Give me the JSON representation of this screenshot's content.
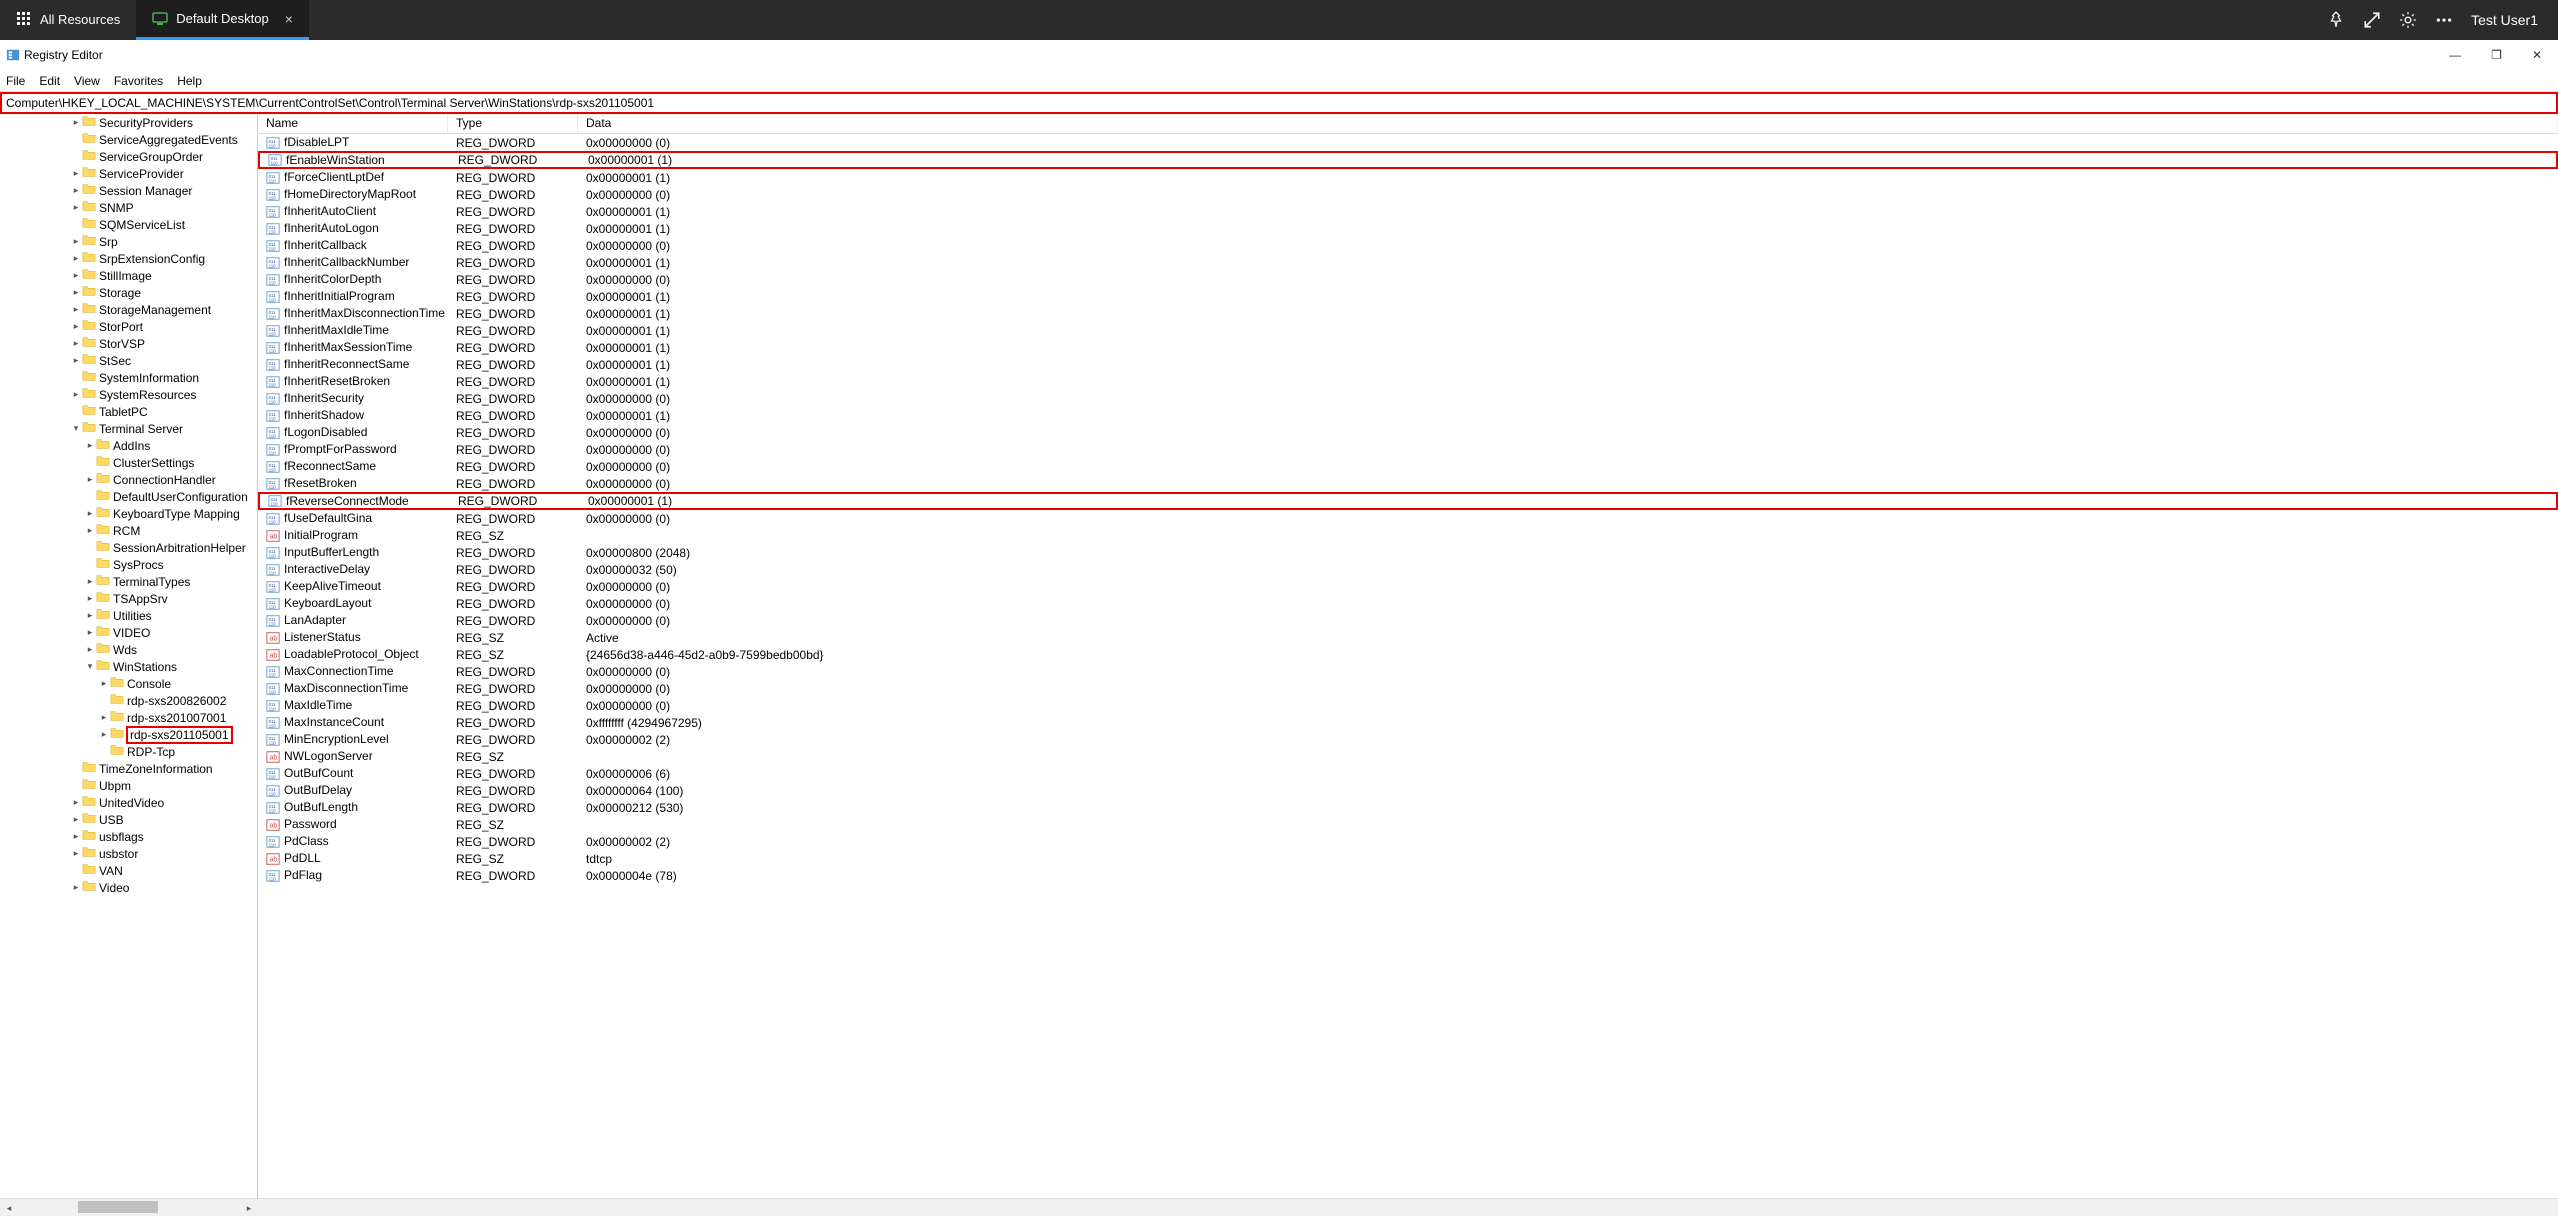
{
  "top_bar": {
    "all_resources": "All Resources",
    "active_tab": "Default Desktop",
    "user": "Test User1"
  },
  "window": {
    "title": "Registry Editor"
  },
  "menu": {
    "file": "File",
    "edit": "Edit",
    "view": "View",
    "favorites": "Favorites",
    "help": "Help"
  },
  "address": "Computer\\HKEY_LOCAL_MACHINE\\SYSTEM\\CurrentControlSet\\Control\\Terminal Server\\WinStations\\rdp-sxs201105001",
  "tree": [
    {
      "label": "SecurityProviders",
      "indent": 5,
      "exp": "▸"
    },
    {
      "label": "ServiceAggregatedEvents",
      "indent": 5,
      "exp": ""
    },
    {
      "label": "ServiceGroupOrder",
      "indent": 5,
      "exp": ""
    },
    {
      "label": "ServiceProvider",
      "indent": 5,
      "exp": "▸"
    },
    {
      "label": "Session Manager",
      "indent": 5,
      "exp": "▸"
    },
    {
      "label": "SNMP",
      "indent": 5,
      "exp": "▸"
    },
    {
      "label": "SQMServiceList",
      "indent": 5,
      "exp": ""
    },
    {
      "label": "Srp",
      "indent": 5,
      "exp": "▸"
    },
    {
      "label": "SrpExtensionConfig",
      "indent": 5,
      "exp": "▸"
    },
    {
      "label": "StillImage",
      "indent": 5,
      "exp": "▸"
    },
    {
      "label": "Storage",
      "indent": 5,
      "exp": "▸"
    },
    {
      "label": "StorageManagement",
      "indent": 5,
      "exp": "▸"
    },
    {
      "label": "StorPort",
      "indent": 5,
      "exp": "▸"
    },
    {
      "label": "StorVSP",
      "indent": 5,
      "exp": "▸"
    },
    {
      "label": "StSec",
      "indent": 5,
      "exp": "▸"
    },
    {
      "label": "SystemInformation",
      "indent": 5,
      "exp": ""
    },
    {
      "label": "SystemResources",
      "indent": 5,
      "exp": "▸"
    },
    {
      "label": "TabletPC",
      "indent": 5,
      "exp": ""
    },
    {
      "label": "Terminal Server",
      "indent": 5,
      "exp": "▾"
    },
    {
      "label": "AddIns",
      "indent": 6,
      "exp": "▸"
    },
    {
      "label": "ClusterSettings",
      "indent": 6,
      "exp": ""
    },
    {
      "label": "ConnectionHandler",
      "indent": 6,
      "exp": "▸"
    },
    {
      "label": "DefaultUserConfiguration",
      "indent": 6,
      "exp": ""
    },
    {
      "label": "KeyboardType Mapping",
      "indent": 6,
      "exp": "▸"
    },
    {
      "label": "RCM",
      "indent": 6,
      "exp": "▸"
    },
    {
      "label": "SessionArbitrationHelper",
      "indent": 6,
      "exp": ""
    },
    {
      "label": "SysProcs",
      "indent": 6,
      "exp": ""
    },
    {
      "label": "TerminalTypes",
      "indent": 6,
      "exp": "▸"
    },
    {
      "label": "TSAppSrv",
      "indent": 6,
      "exp": "▸"
    },
    {
      "label": "Utilities",
      "indent": 6,
      "exp": "▸"
    },
    {
      "label": "VIDEO",
      "indent": 6,
      "exp": "▸"
    },
    {
      "label": "Wds",
      "indent": 6,
      "exp": "▸"
    },
    {
      "label": "WinStations",
      "indent": 6,
      "exp": "▾"
    },
    {
      "label": "Console",
      "indent": 7,
      "exp": "▸"
    },
    {
      "label": "rdp-sxs200826002",
      "indent": 7,
      "exp": ""
    },
    {
      "label": "rdp-sxs201007001",
      "indent": 7,
      "exp": "▸"
    },
    {
      "label": "rdp-sxs201105001",
      "indent": 7,
      "exp": "▸",
      "selected": true
    },
    {
      "label": "RDP-Tcp",
      "indent": 7,
      "exp": ""
    },
    {
      "label": "TimeZoneInformation",
      "indent": 5,
      "exp": ""
    },
    {
      "label": "Ubpm",
      "indent": 5,
      "exp": ""
    },
    {
      "label": "UnitedVideo",
      "indent": 5,
      "exp": "▸"
    },
    {
      "label": "USB",
      "indent": 5,
      "exp": "▸"
    },
    {
      "label": "usbflags",
      "indent": 5,
      "exp": "▸"
    },
    {
      "label": "usbstor",
      "indent": 5,
      "exp": "▸"
    },
    {
      "label": "VAN",
      "indent": 5,
      "exp": ""
    },
    {
      "label": "Video",
      "indent": 5,
      "exp": "▸"
    }
  ],
  "list_header": {
    "name": "Name",
    "type": "Type",
    "data": "Data"
  },
  "values": [
    {
      "name": "fDisableLPT",
      "type": "REG_DWORD",
      "data": "0x00000000 (0)",
      "icon": "bin"
    },
    {
      "name": "fEnableWinStation",
      "type": "REG_DWORD",
      "data": "0x00000001 (1)",
      "icon": "bin",
      "hl": true
    },
    {
      "name": "fForceClientLptDef",
      "type": "REG_DWORD",
      "data": "0x00000001 (1)",
      "icon": "bin"
    },
    {
      "name": "fHomeDirectoryMapRoot",
      "type": "REG_DWORD",
      "data": "0x00000000 (0)",
      "icon": "bin"
    },
    {
      "name": "fInheritAutoClient",
      "type": "REG_DWORD",
      "data": "0x00000001 (1)",
      "icon": "bin"
    },
    {
      "name": "fInheritAutoLogon",
      "type": "REG_DWORD",
      "data": "0x00000001 (1)",
      "icon": "bin"
    },
    {
      "name": "fInheritCallback",
      "type": "REG_DWORD",
      "data": "0x00000000 (0)",
      "icon": "bin"
    },
    {
      "name": "fInheritCallbackNumber",
      "type": "REG_DWORD",
      "data": "0x00000001 (1)",
      "icon": "bin"
    },
    {
      "name": "fInheritColorDepth",
      "type": "REG_DWORD",
      "data": "0x00000000 (0)",
      "icon": "bin"
    },
    {
      "name": "fInheritInitialProgram",
      "type": "REG_DWORD",
      "data": "0x00000001 (1)",
      "icon": "bin"
    },
    {
      "name": "fInheritMaxDisconnectionTime",
      "type": "REG_DWORD",
      "data": "0x00000001 (1)",
      "icon": "bin"
    },
    {
      "name": "fInheritMaxIdleTime",
      "type": "REG_DWORD",
      "data": "0x00000001 (1)",
      "icon": "bin"
    },
    {
      "name": "fInheritMaxSessionTime",
      "type": "REG_DWORD",
      "data": "0x00000001 (1)",
      "icon": "bin"
    },
    {
      "name": "fInheritReconnectSame",
      "type": "REG_DWORD",
      "data": "0x00000001 (1)",
      "icon": "bin"
    },
    {
      "name": "fInheritResetBroken",
      "type": "REG_DWORD",
      "data": "0x00000001 (1)",
      "icon": "bin"
    },
    {
      "name": "fInheritSecurity",
      "type": "REG_DWORD",
      "data": "0x00000000 (0)",
      "icon": "bin"
    },
    {
      "name": "fInheritShadow",
      "type": "REG_DWORD",
      "data": "0x00000001 (1)",
      "icon": "bin"
    },
    {
      "name": "fLogonDisabled",
      "type": "REG_DWORD",
      "data": "0x00000000 (0)",
      "icon": "bin"
    },
    {
      "name": "fPromptForPassword",
      "type": "REG_DWORD",
      "data": "0x00000000 (0)",
      "icon": "bin"
    },
    {
      "name": "fReconnectSame",
      "type": "REG_DWORD",
      "data": "0x00000000 (0)",
      "icon": "bin"
    },
    {
      "name": "fResetBroken",
      "type": "REG_DWORD",
      "data": "0x00000000 (0)",
      "icon": "bin"
    },
    {
      "name": "fReverseConnectMode",
      "type": "REG_DWORD",
      "data": "0x00000001 (1)",
      "icon": "bin",
      "hl": true
    },
    {
      "name": "fUseDefaultGina",
      "type": "REG_DWORD",
      "data": "0x00000000 (0)",
      "icon": "bin"
    },
    {
      "name": "InitialProgram",
      "type": "REG_SZ",
      "data": "",
      "icon": "str"
    },
    {
      "name": "InputBufferLength",
      "type": "REG_DWORD",
      "data": "0x00000800 (2048)",
      "icon": "bin"
    },
    {
      "name": "InteractiveDelay",
      "type": "REG_DWORD",
      "data": "0x00000032 (50)",
      "icon": "bin"
    },
    {
      "name": "KeepAliveTimeout",
      "type": "REG_DWORD",
      "data": "0x00000000 (0)",
      "icon": "bin"
    },
    {
      "name": "KeyboardLayout",
      "type": "REG_DWORD",
      "data": "0x00000000 (0)",
      "icon": "bin"
    },
    {
      "name": "LanAdapter",
      "type": "REG_DWORD",
      "data": "0x00000000 (0)",
      "icon": "bin"
    },
    {
      "name": "ListenerStatus",
      "type": "REG_SZ",
      "data": "Active",
      "icon": "str"
    },
    {
      "name": "LoadableProtocol_Object",
      "type": "REG_SZ",
      "data": "{24656d38-a446-45d2-a0b9-7599bedb00bd}",
      "icon": "str"
    },
    {
      "name": "MaxConnectionTime",
      "type": "REG_DWORD",
      "data": "0x00000000 (0)",
      "icon": "bin"
    },
    {
      "name": "MaxDisconnectionTime",
      "type": "REG_DWORD",
      "data": "0x00000000 (0)",
      "icon": "bin"
    },
    {
      "name": "MaxIdleTime",
      "type": "REG_DWORD",
      "data": "0x00000000 (0)",
      "icon": "bin"
    },
    {
      "name": "MaxInstanceCount",
      "type": "REG_DWORD",
      "data": "0xffffffff (4294967295)",
      "icon": "bin"
    },
    {
      "name": "MinEncryptionLevel",
      "type": "REG_DWORD",
      "data": "0x00000002 (2)",
      "icon": "bin"
    },
    {
      "name": "NWLogonServer",
      "type": "REG_SZ",
      "data": "",
      "icon": "str"
    },
    {
      "name": "OutBufCount",
      "type": "REG_DWORD",
      "data": "0x00000006 (6)",
      "icon": "bin"
    },
    {
      "name": "OutBufDelay",
      "type": "REG_DWORD",
      "data": "0x00000064 (100)",
      "icon": "bin"
    },
    {
      "name": "OutBufLength",
      "type": "REG_DWORD",
      "data": "0x00000212 (530)",
      "icon": "bin"
    },
    {
      "name": "Password",
      "type": "REG_SZ",
      "data": "",
      "icon": "str"
    },
    {
      "name": "PdClass",
      "type": "REG_DWORD",
      "data": "0x00000002 (2)",
      "icon": "bin"
    },
    {
      "name": "PdDLL",
      "type": "REG_SZ",
      "data": "tdtcp",
      "icon": "str"
    },
    {
      "name": "PdFlag",
      "type": "REG_DWORD",
      "data": "0x0000004e (78)",
      "icon": "bin"
    }
  ]
}
